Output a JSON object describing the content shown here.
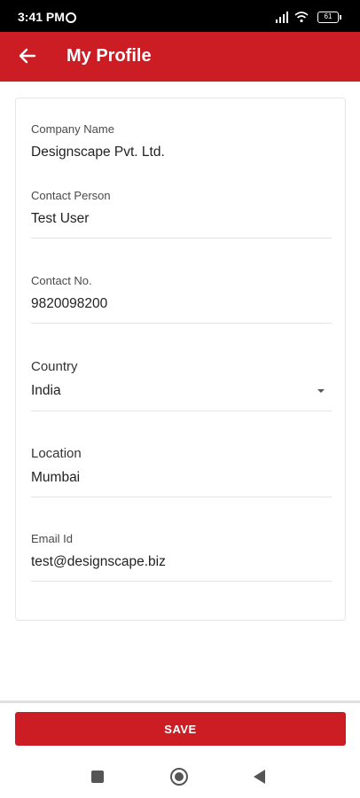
{
  "status_bar": {
    "time": "3:41 PM",
    "battery": "61"
  },
  "app_bar": {
    "title": "My Profile"
  },
  "form": {
    "company_name": {
      "label": "Company Name",
      "value": "Designscape Pvt. Ltd."
    },
    "contact_person": {
      "label": "Contact Person",
      "value": "Test User"
    },
    "contact_no": {
      "label": "Contact No.",
      "value": "9820098200"
    },
    "country": {
      "label": "Country",
      "value": "India"
    },
    "location": {
      "label": "Location",
      "value": "Mumbai"
    },
    "email": {
      "label": "Email Id",
      "value": "test@designscape.biz"
    }
  },
  "actions": {
    "save_label": "SAVE"
  },
  "colors": {
    "primary": "#cc1d24"
  }
}
